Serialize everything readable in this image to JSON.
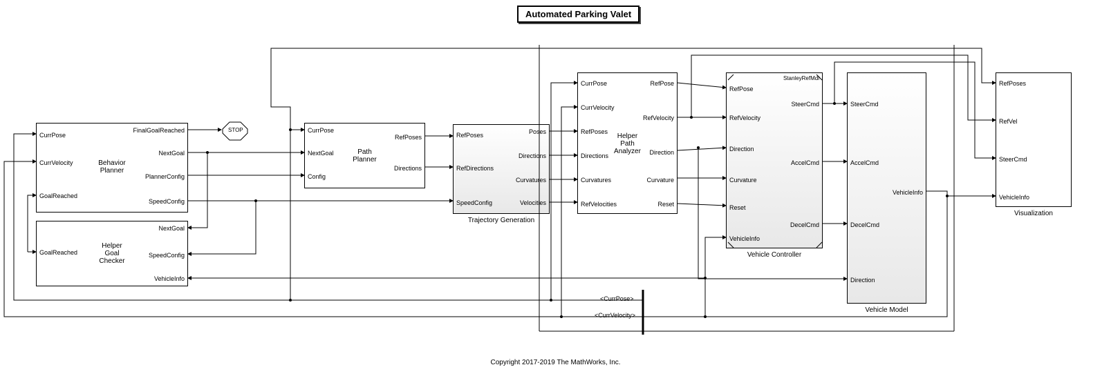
{
  "chart_data": {
    "type": "block-diagram",
    "title": "Automated Parking Valet",
    "blocks": [
      {
        "name": "Behavior Planner",
        "inputs": [
          "CurrPose",
          "CurrVelocity",
          "GoalReached"
        ],
        "outputs": [
          "FinalGoalReached",
          "NextGoal",
          "PlannerConfig",
          "SpeedConfig"
        ]
      },
      {
        "name": "Helper Goal Checker",
        "inputs": [
          "GoalReached"
        ],
        "outputs": [
          "NextGoal",
          "SpeedConfig",
          "VehicleInfo"
        ]
      },
      {
        "name": "Path Planner",
        "inputs": [
          "CurrPose",
          "NextGoal",
          "Config"
        ],
        "outputs": [
          "RefPoses",
          "Directions"
        ]
      },
      {
        "name": "Trajectory Generation",
        "inputs": [
          "RefPoses",
          "RefDirections",
          "SpeedConfig"
        ],
        "outputs": [
          "Poses",
          "Directions",
          "Curvatures",
          "Velocities"
        ]
      },
      {
        "name": "Helper Path Analyzer",
        "inputs": [
          "CurrPose",
          "CurrVelocity",
          "RefPoses",
          "Directions",
          "Curvatures",
          "RefVelocities"
        ],
        "outputs": [
          "RefPose",
          "RefVelocity",
          "Direction",
          "Curvature",
          "Reset"
        ]
      },
      {
        "name": "Vehicle Controller",
        "ref": "StanleyRefMdl",
        "inputs": [
          "RefPose",
          "RefVelocity",
          "Direction",
          "Curvature",
          "Reset",
          "VehicleInfo"
        ],
        "outputs": [
          "SteerCmd",
          "AccelCmd",
          "DecelCmd"
        ]
      },
      {
        "name": "Vehicle Model",
        "inputs": [
          "SteerCmd",
          "AccelCmd",
          "DecelCmd",
          "Direction"
        ],
        "outputs": [
          "VehicleInfo"
        ]
      },
      {
        "name": "Visualization",
        "inputs": [
          "RefPoses",
          "RefVel",
          "SteerCmd",
          "VehicleInfo"
        ],
        "outputs": []
      }
    ],
    "bus_signals": [
      "<CurrPose>",
      "<CurrVelocity>"
    ],
    "stop_block": "STOP",
    "copyright": "Copyright 2017-2019 The MathWorks, Inc."
  },
  "title": "Automated Parking Valet",
  "stop": "STOP",
  "copyright": "Copyright 2017-2019 The MathWorks, Inc.",
  "behavior": {
    "name": "Behavior\nPlanner",
    "in1": "CurrPose",
    "in2": "CurrVelocity",
    "in3": "GoalReached",
    "out1": "FinalGoalReached",
    "out2": "NextGoal",
    "out3": "PlannerConfig",
    "out4": "SpeedConfig"
  },
  "goalchecker": {
    "name": "Helper\nGoal\nChecker",
    "in1": "GoalReached",
    "out1": "NextGoal",
    "out2": "SpeedConfig",
    "out3": "VehicleInfo"
  },
  "pathplanner": {
    "name": "Path\nPlanner",
    "in1": "CurrPose",
    "in2": "NextGoal",
    "in3": "Config",
    "out1": "RefPoses",
    "out2": "Directions"
  },
  "trajgen": {
    "name": "Trajectory Generation",
    "in1": "RefPoses",
    "in2": "RefDirections",
    "in3": "SpeedConfig",
    "out1": "Poses",
    "out2": "Directions",
    "out3": "Curvatures",
    "out4": "Velocities"
  },
  "analyzer": {
    "name": "Helper\nPath\nAnalyzer",
    "in1": "CurrPose",
    "in2": "CurrVelocity",
    "in3": "RefPoses",
    "in4": "Directions",
    "in5": "Curvatures",
    "in6": "RefVelocities",
    "out1": "RefPose",
    "out2": "RefVelocity",
    "out3": "Direction",
    "out4": "Curvature",
    "out5": "Reset"
  },
  "controller": {
    "name": "Vehicle Controller",
    "ref": "StanleyRefMdl",
    "in1": "RefPose",
    "in2": "RefVelocity",
    "in3": "Direction",
    "in4": "Curvature",
    "in5": "Reset",
    "in6": "VehicleInfo",
    "out1": "SteerCmd",
    "out2": "AccelCmd",
    "out3": "DecelCmd"
  },
  "vehmodel": {
    "name": "Vehicle Model",
    "in1": "SteerCmd",
    "in2": "AccelCmd",
    "in3": "DecelCmd",
    "in4": "Direction",
    "out1": "VehicleInfo"
  },
  "viz": {
    "name": "Visualization",
    "in1": "RefPoses",
    "in2": "RefVel",
    "in3": "SteerCmd",
    "in4": "VehicleInfo"
  },
  "bus": {
    "cp": "<CurrPose>",
    "cv": "<CurrVelocity>"
  }
}
